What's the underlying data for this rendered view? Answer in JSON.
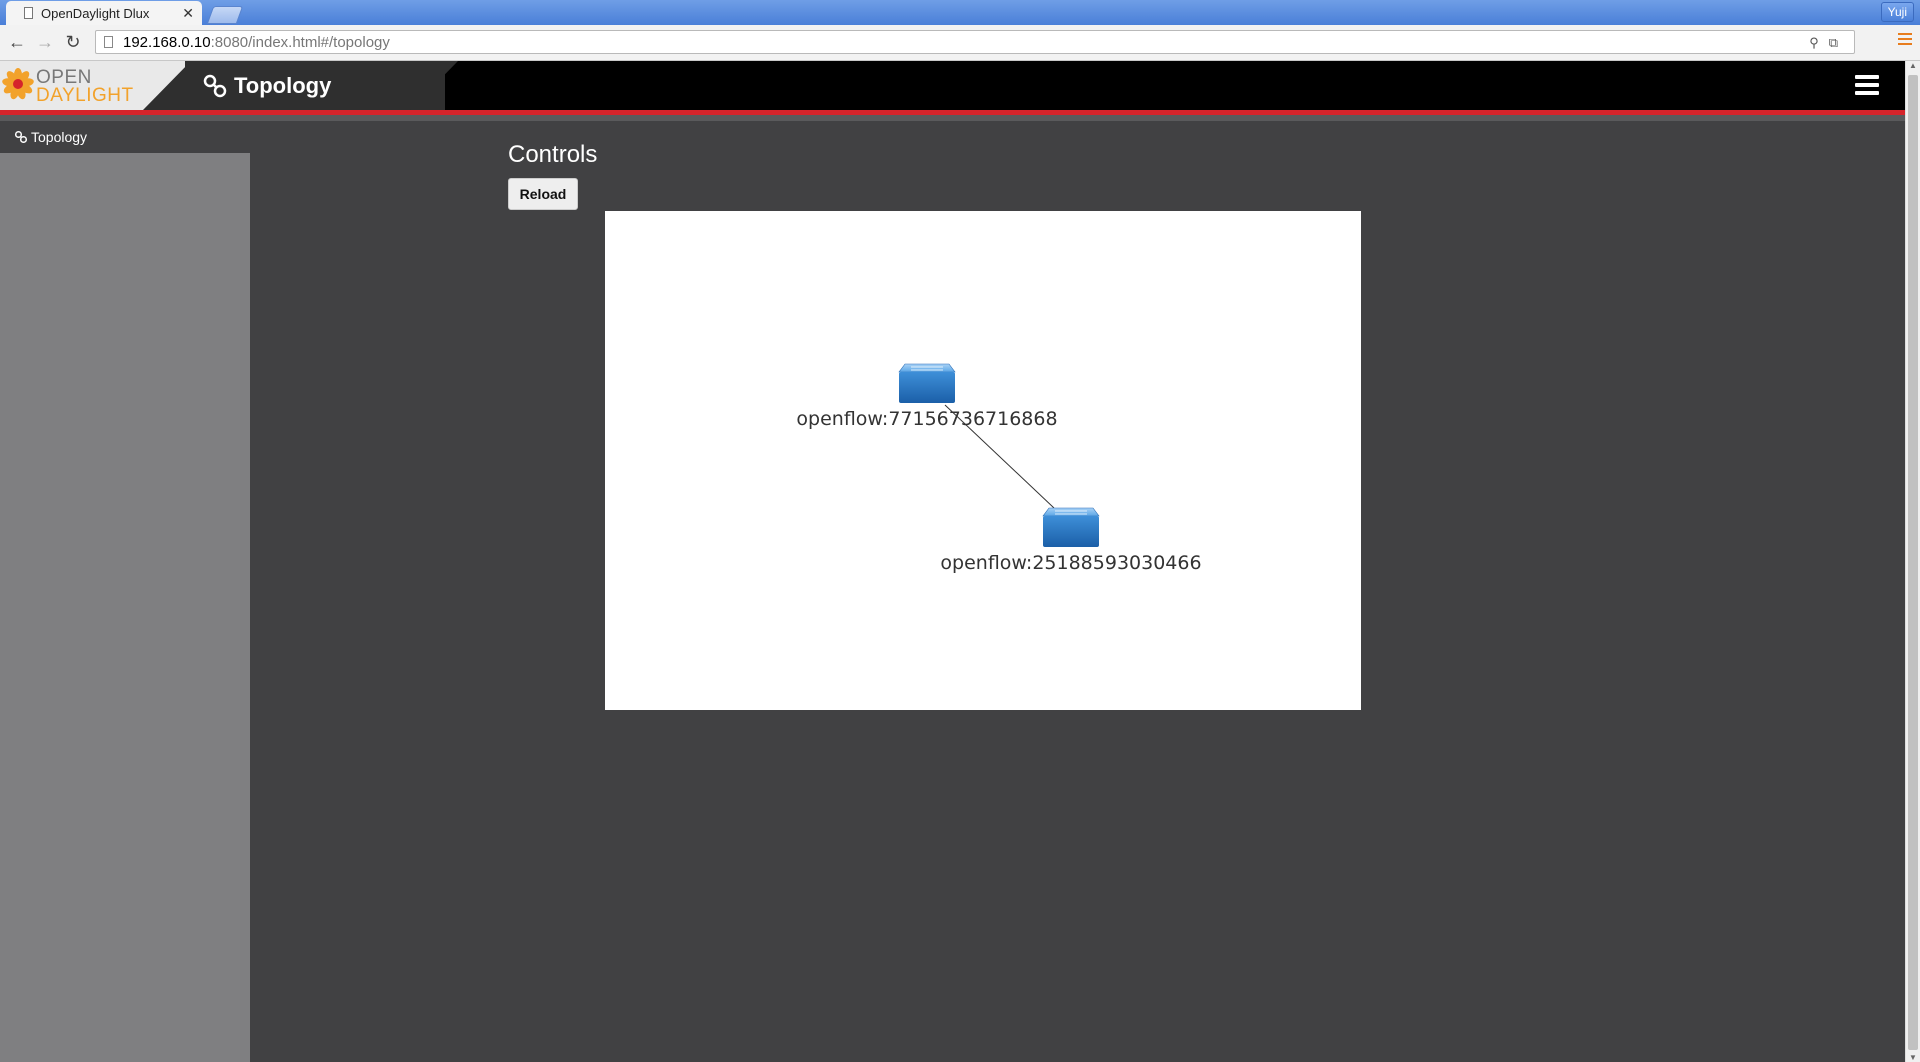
{
  "browser": {
    "tab_title": "OpenDaylight Dlux",
    "tab_close": "✕",
    "user_name": "Yuji",
    "url_host": "192.168.0.10",
    "url_rest": ":8080/index.html#/topology",
    "back_icon": "←",
    "forward_icon": "→",
    "reload_icon": "↻"
  },
  "header": {
    "logo_line1": "OPEN",
    "logo_line2": "DAYLIGHT",
    "title": "Topology"
  },
  "sidebar": {
    "items": [
      {
        "label": "Topology"
      }
    ]
  },
  "main": {
    "controls_heading": "Controls",
    "reload_label": "Reload"
  },
  "topology": {
    "nodes": [
      {
        "id": "openflow:77156736716868",
        "label": "openflow:77156736716868"
      },
      {
        "id": "openflow:25188593030466",
        "label": "openflow:25188593030466"
      }
    ],
    "links": [
      {
        "source": "openflow:77156736716868",
        "target": "openflow:25188593030466"
      }
    ]
  },
  "colors": {
    "accent_red": "#d5242b",
    "logo_orange": "#f2a22b",
    "switch_blue": "#3e8fd8"
  }
}
